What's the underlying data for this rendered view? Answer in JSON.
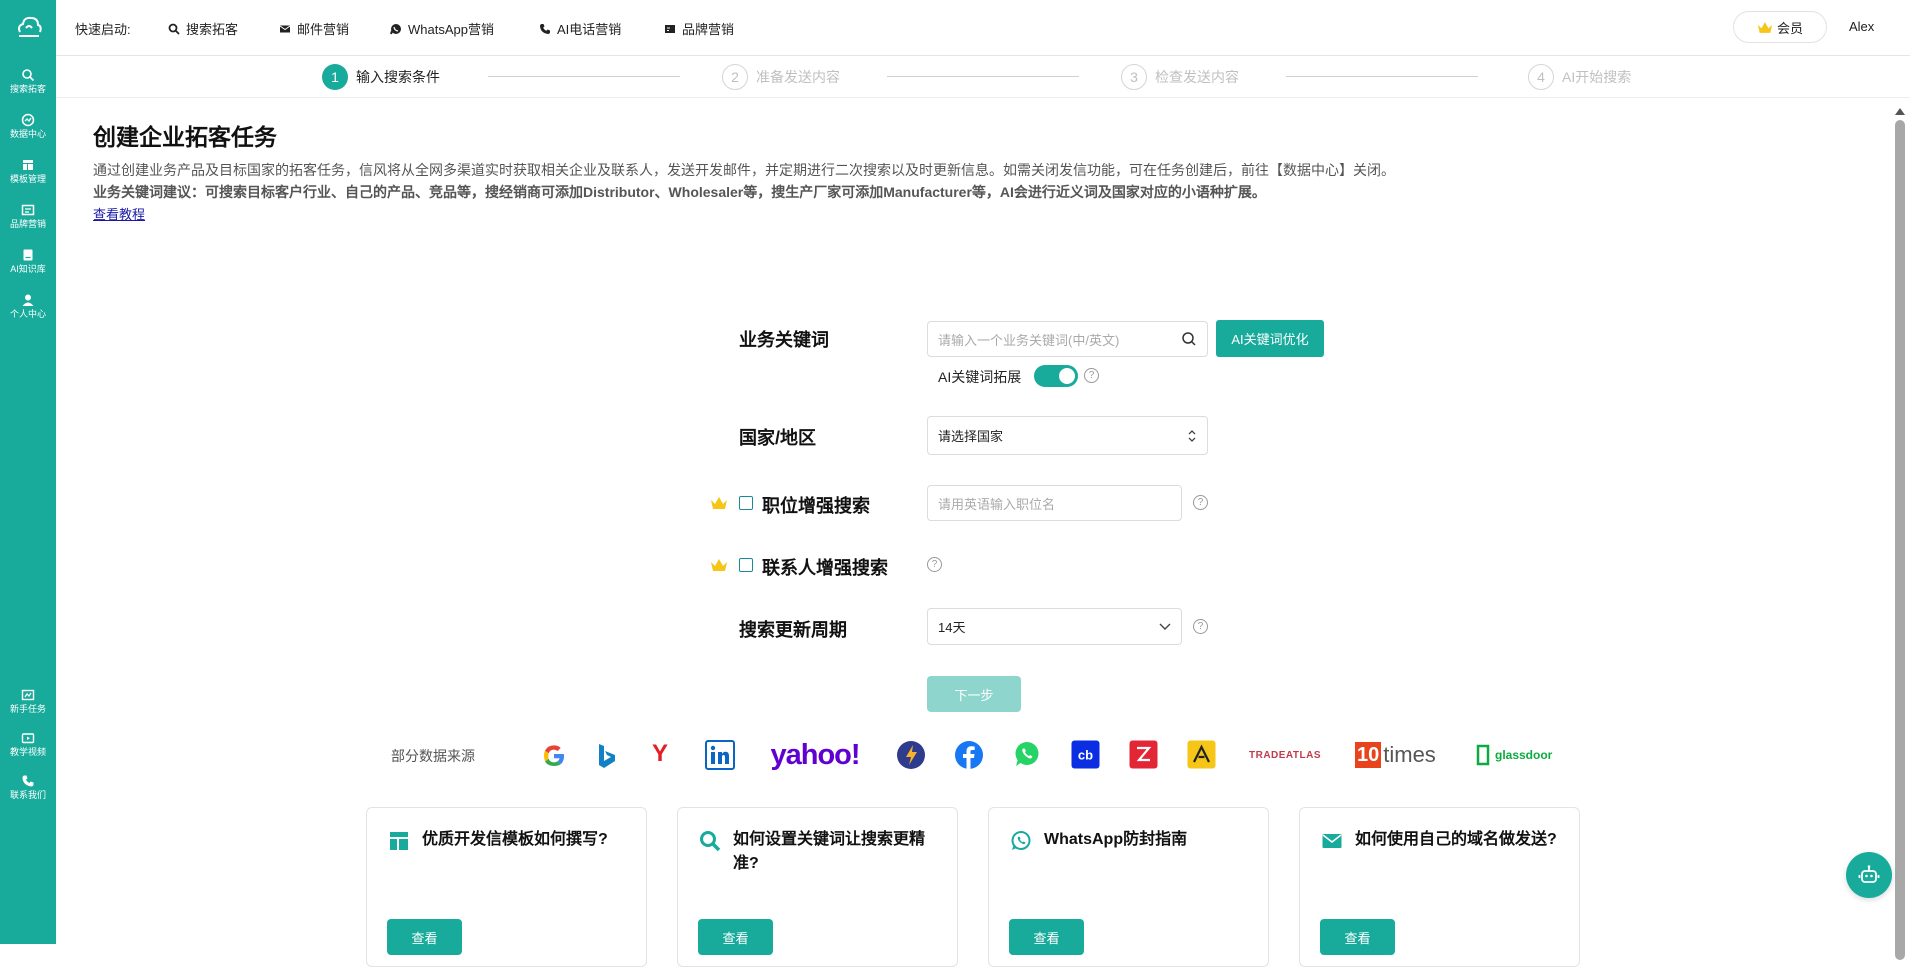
{
  "sidebar": {
    "items": [
      {
        "label": "搜索拓客",
        "icon": "search-icon"
      },
      {
        "label": "数据中心",
        "icon": "chart-icon"
      },
      {
        "label": "模板管理",
        "icon": "template-icon"
      },
      {
        "label": "品牌营销",
        "icon": "brand-icon"
      },
      {
        "label": "AI知识库",
        "icon": "book-icon"
      },
      {
        "label": "个人中心",
        "icon": "user-icon"
      }
    ],
    "bottom": [
      {
        "label": "新手任务",
        "icon": "task-icon"
      },
      {
        "label": "教学视频",
        "icon": "video-icon"
      },
      {
        "label": "联系我们",
        "icon": "phone-icon"
      }
    ]
  },
  "topbar": {
    "quick_label": "快速启动:",
    "quick_items": [
      "搜索拓客",
      "邮件营销",
      "WhatsApp营销",
      "AI电话营销",
      "品牌营销"
    ],
    "vip_label": "会员",
    "user_name": "Alex"
  },
  "steps": [
    {
      "num": "1",
      "label": "输入搜索条件"
    },
    {
      "num": "2",
      "label": "准备发送内容"
    },
    {
      "num": "3",
      "label": "检查发送内容"
    },
    {
      "num": "4",
      "label": "AI开始搜索"
    }
  ],
  "header": {
    "title": "创建企业拓客任务",
    "desc1": "通过创建业务产品及目标国家的拓客任务，信风将从全网多渠道实时获取相关企业及联系人，发送开发邮件，并定期进行二次搜索以及时更新信息。如需关闭发信功能，可在任务创建后，前往【数据中心】关闭。",
    "desc2": "业务关键词建议：可搜索目标客户行业、自己的产品、竞品等，搜经销商可添加Distributor、Wholesaler等，搜生产厂家可添加Manufacturer等，AI会进行近义词及国家对应的小语种扩展。",
    "tutorial": "查看教程"
  },
  "form": {
    "keyword_label": "业务关键词",
    "keyword_placeholder": "请输入一个业务关键词(中/英文)",
    "ai_optimize": "AI关键词优化",
    "ai_expand_label": "AI关键词拓展",
    "ai_expand_on": true,
    "country_label": "国家/地区",
    "country_value": "请选择国家",
    "job_label": "职位增强搜索",
    "job_placeholder": "请用英语输入职位名",
    "contact_label": "联系人增强搜索",
    "period_label": "搜索更新周期",
    "period_value": "14天",
    "next": "下一步"
  },
  "sources": {
    "label": "部分数据来源",
    "logos": [
      "google",
      "bing",
      "yandex",
      "linkedin",
      "yahoo",
      "startpage",
      "facebook",
      "whatsapp",
      "crunchbase",
      "zoominfo",
      "apollo",
      "tradeatlas",
      "10times",
      "glassdoor"
    ],
    "yahoo_text": "yahoo!",
    "tradeatlas_text": "TRADEATLAS",
    "tenx_num": "10",
    "tenx_word": "times",
    "glassdoor_text": "glassdoor",
    "cb_text": "cb"
  },
  "cards": [
    {
      "title": "优质开发信模板如何撰写?",
      "button": "查看",
      "icon": "template-icon"
    },
    {
      "title": "如何设置关键词让搜索更精准?",
      "button": "查看",
      "icon": "search-icon"
    },
    {
      "title": "WhatsApp防封指南",
      "button": "查看",
      "icon": "whatsapp-icon"
    },
    {
      "title": "如何使用自己的域名做发送?",
      "button": "查看",
      "icon": "mail-icon"
    }
  ],
  "colors": {
    "primary": "#18ab9c",
    "crown": "#f5c518"
  }
}
